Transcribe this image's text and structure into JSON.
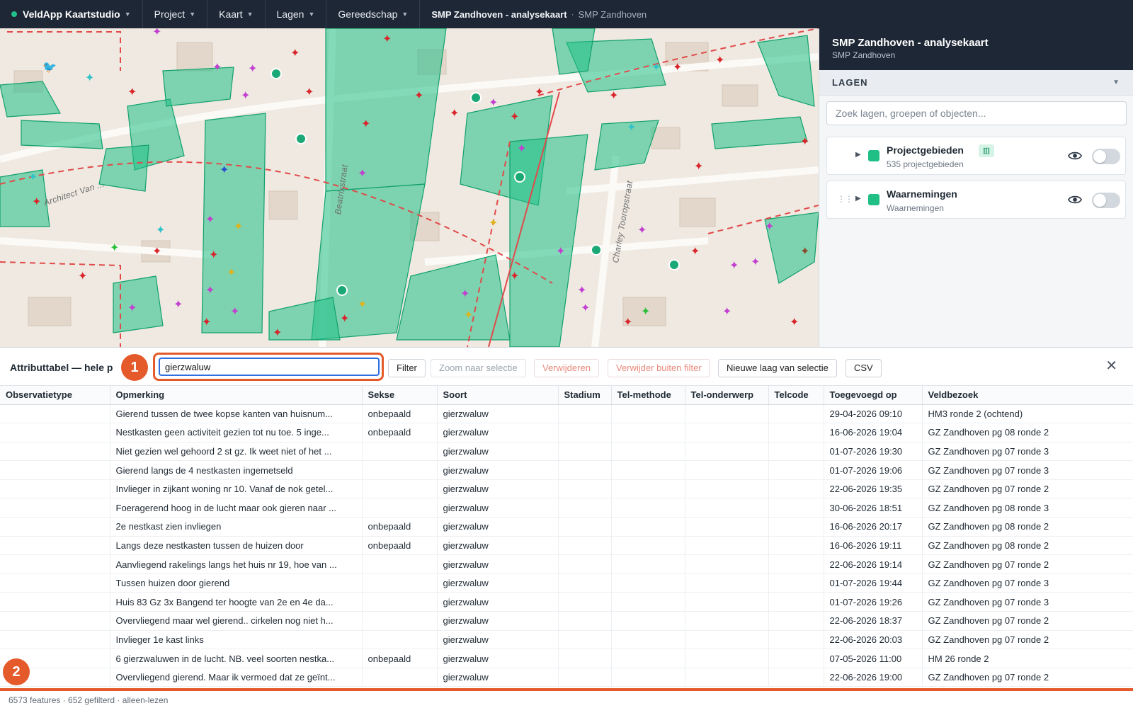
{
  "topbar": {
    "brand": "VeldApp Kaartstudio",
    "menus": [
      "Project",
      "Kaart",
      "Lagen",
      "Gereedschap"
    ],
    "breadcrumb_title": "SMP Zandhoven - analysekaart",
    "breadcrumb_sep": "·",
    "breadcrumb_sub": "SMP Zandhoven"
  },
  "map": {
    "street_labels": [
      "Beatrixstraat",
      "Charley Tooropstraat",
      "Architect Van ..."
    ]
  },
  "panel": {
    "title": "SMP Zandhoven - analysekaart",
    "subtitle": "SMP Zandhoven",
    "section": "LAGEN",
    "section_chevron": "▼",
    "search_placeholder": "Zoek lagen, groepen of objecten...",
    "layers": [
      {
        "name": "Projectgebieden",
        "sub": "535 projectgebieden",
        "color": "#1fbf86"
      },
      {
        "name": "Waarnemingen",
        "sub": "Waarnemingen",
        "color": "#1fbf86"
      }
    ]
  },
  "attr": {
    "title": "Attributtabel — hele p",
    "filter_value": "gierzwaluw",
    "buttons": {
      "filter": "Filter",
      "zoom": "Zoom naar selectie",
      "delete": "Verwijderen",
      "delete_outside": "Verwijder buiten filter",
      "new_layer": "Nieuwe laag van selectie",
      "csv": "CSV"
    },
    "badge1": "1",
    "badge2": "2",
    "columns": [
      "Observatietype",
      "Opmerking",
      "Sekse",
      "Soort",
      "Stadium",
      "Tel-methode",
      "Tel-onderwerp",
      "Telcode",
      "Toegevoegd op",
      "Veldbezoek"
    ],
    "rows": [
      [
        "",
        "Gierend tussen de twee kopse kanten van huisnum...",
        "onbepaald",
        "gierzwaluw",
        "",
        "",
        "",
        "",
        "29-04-2026 09:10",
        "HM3 ronde 2 (ochtend)"
      ],
      [
        "",
        "Nestkasten geen activiteit gezien tot nu toe. 5 inge...",
        "onbepaald",
        "gierzwaluw",
        "",
        "",
        "",
        "",
        "16-06-2026 19:04",
        "GZ Zandhoven pg 08 ronde 2"
      ],
      [
        "",
        "Niet gezien wel gehoord 2 st gz. Ik weet niet of het ...",
        "",
        "gierzwaluw",
        "",
        "",
        "",
        "",
        "01-07-2026 19:30",
        "GZ Zandhoven pg 07 ronde 3"
      ],
      [
        "",
        "Gierend langs de 4 nestkasten ingemetseld",
        "",
        "gierzwaluw",
        "",
        "",
        "",
        "",
        "01-07-2026 19:06",
        "GZ Zandhoven pg 07 ronde 3"
      ],
      [
        "",
        "Invlieger in zijkant woning nr 10. Vanaf de nok getel...",
        "",
        "gierzwaluw",
        "",
        "",
        "",
        "",
        "22-06-2026 19:35",
        "GZ Zandhoven pg 07 ronde 2"
      ],
      [
        "",
        "Foeragerend hoog in de lucht maar ook gieren naar ...",
        "",
        "gierzwaluw",
        "",
        "",
        "",
        "",
        "30-06-2026 18:51",
        "GZ Zandhoven pg 08 ronde 3"
      ],
      [
        "",
        "2e nestkast zien invliegen",
        "onbepaald",
        "gierzwaluw",
        "",
        "",
        "",
        "",
        "16-06-2026 20:17",
        "GZ Zandhoven pg 08 ronde 2"
      ],
      [
        "",
        "Langs deze nestkasten tussen de huizen door",
        "onbepaald",
        "gierzwaluw",
        "",
        "",
        "",
        "",
        "16-06-2026 19:11",
        "GZ Zandhoven pg 08 ronde 2"
      ],
      [
        "",
        "Aanvliegend rakelings langs het huis nr 19, hoe van ...",
        "",
        "gierzwaluw",
        "",
        "",
        "",
        "",
        "22-06-2026 19:14",
        "GZ Zandhoven pg 07 ronde 2"
      ],
      [
        "",
        "Tussen huizen door gierend",
        "",
        "gierzwaluw",
        "",
        "",
        "",
        "",
        "01-07-2026 19:44",
        "GZ Zandhoven pg 07 ronde 3"
      ],
      [
        "",
        "Huis 83 Gz 3x Bangend ter hoogte van 2e en 4e da...",
        "",
        "gierzwaluw",
        "",
        "",
        "",
        "",
        "01-07-2026 19:26",
        "GZ Zandhoven pg 07 ronde 3"
      ],
      [
        "",
        "Overvliegend maar wel gierend.. cirkelen nog niet h...",
        "",
        "gierzwaluw",
        "",
        "",
        "",
        "",
        "22-06-2026 18:37",
        "GZ Zandhoven pg 07 ronde 2"
      ],
      [
        "",
        "Invlieger 1e kast links",
        "",
        "gierzwaluw",
        "",
        "",
        "",
        "",
        "22-06-2026 20:03",
        "GZ Zandhoven pg 07 ronde 2"
      ],
      [
        "",
        "6 gierzwaluwen in de lucht. NB. veel soorten nestka...",
        "onbepaald",
        "gierzwaluw",
        "",
        "",
        "",
        "",
        "07-05-2026 11:00",
        "HM 26 ronde 2"
      ],
      [
        "",
        "Overvliegend gierend. Maar ik vermoed dat ze geïnt...",
        "",
        "gierzwaluw",
        "",
        "",
        "",
        "",
        "22-06-2026 19:00",
        "GZ Zandhoven pg 07 ronde 2"
      ]
    ],
    "status": "6573 features · 652 gefilterd · alleen-lezen"
  },
  "colors": {
    "accent": "#e55a2b",
    "topbar": "#1e2735",
    "polygon": "#1fbf86",
    "marker_red": "#d8262b",
    "marker_purple": "#c23fd0",
    "marker_yellow": "#e0b21b"
  }
}
